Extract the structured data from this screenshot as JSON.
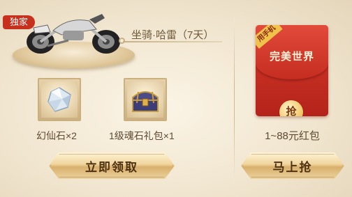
{
  "left_panel": {
    "exclusive_tag": "独家",
    "mount": {
      "label": "坐骑·哈雷（7天）",
      "icon": "motorcycle-icon"
    },
    "items": [
      {
        "label": "幻仙石×2",
        "icon": "gemstone-icon"
      },
      {
        "label": "1级魂石礼包×1",
        "icon": "treasure-chest-icon"
      }
    ],
    "claim_button": "立即领取"
  },
  "right_panel": {
    "envelope": {
      "corner_badge": "用手机",
      "logo_text": "完美世界",
      "coin_text": "抢"
    },
    "reward_label": "1~88元红包",
    "grab_button": "马上抢"
  },
  "colors": {
    "accent_red": "#c8301e",
    "gold": "#f0d49c"
  }
}
